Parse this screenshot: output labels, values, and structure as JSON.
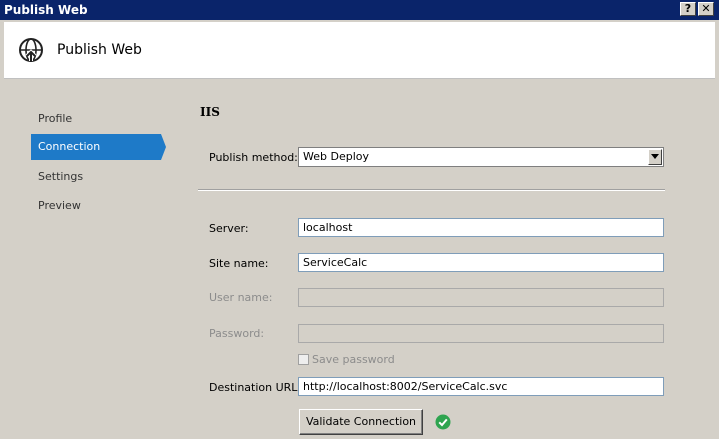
{
  "window": {
    "title": "Publish Web",
    "help_btn": "?",
    "close_btn": "✕"
  },
  "header": {
    "title": "Publish Web",
    "icon": "globe-publish-icon"
  },
  "nav": {
    "items": [
      {
        "label": "Profile"
      },
      {
        "label": "Connection",
        "active": true
      },
      {
        "label": "Settings"
      },
      {
        "label": "Preview"
      }
    ]
  },
  "section": {
    "title": "IIS"
  },
  "publish_method": {
    "label": "Publish method:",
    "value": "Web Deploy"
  },
  "fields": {
    "server": {
      "label": "Server:",
      "value": "localhost"
    },
    "site_name": {
      "label": "Site name:",
      "value": "ServiceCalc"
    },
    "user_name": {
      "label": "User name:",
      "value": ""
    },
    "password": {
      "label": "Password:",
      "value": ""
    },
    "destination_url": {
      "label": "Destination URL:",
      "value": "http://localhost:8002/ServiceCalc.svc"
    }
  },
  "save_password": {
    "label": "Save password",
    "checked": false
  },
  "validate_button": {
    "label": "Validate Connection"
  },
  "status": {
    "icon": "check-success-icon",
    "color": "#2ea44f"
  },
  "colors": {
    "accent": "#1e7ac8",
    "titlebar": "#0a246a"
  }
}
